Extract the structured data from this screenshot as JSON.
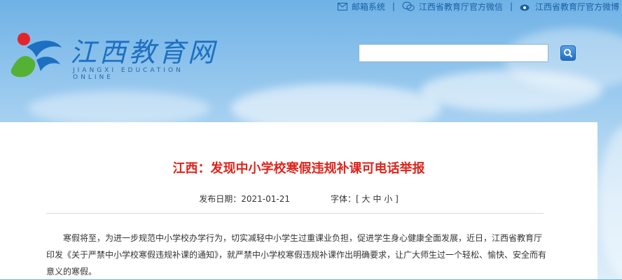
{
  "topbar": {
    "mail_label": "邮箱系统",
    "separator": "|",
    "wechat_label": "江西省教育厅官方微信",
    "weibo_label": "江西省教育厅官方微博"
  },
  "logo": {
    "cn": "江西教育网",
    "en": "JIANGXI EDUCATION ONLINE"
  },
  "search": {
    "value": "",
    "placeholder": ""
  },
  "article": {
    "title": "江西：发现中小学校寒假违规补课可电话举报",
    "date_label": "发布日期：",
    "date_value": "2021-01-21",
    "font_label": "字体：[",
    "font_large": "大",
    "font_medium": "中",
    "font_small": "小",
    "font_close": "]",
    "paragraph": "寒假将至，为进一步规范中小学校办学行为，切实减轻中小学生过重课业负担，促进学生身心健康全面发展，近日，江西省教育厅印发《关于严禁中小学校寒假违规补课的通知》，就严禁中小学校寒假违规补课作出明确要求，让广大师生过一个轻松、愉快、安全而有意义的寒假。"
  },
  "colors": {
    "title_red": "#e0231b",
    "brand_blue": "#1d6fc1"
  }
}
